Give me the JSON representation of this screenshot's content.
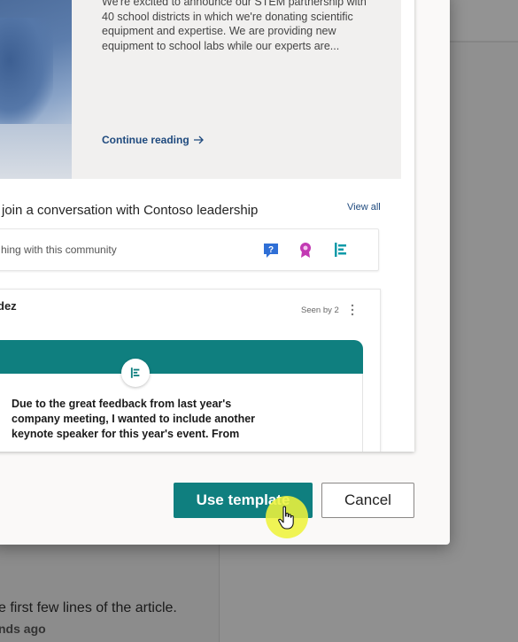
{
  "background_page": {
    "article_snippet": "e first few lines of the article.",
    "timestamp": "nds ago"
  },
  "dialog": {
    "preview": {
      "news_card": {
        "excerpt_lines": [
          "We're excited to announce our STEM partnership with",
          "40 school districts in which we're donating scientific",
          "equipment and expertise. We are providing new",
          "equipment to school labs while our experts are..."
        ],
        "continue_label": "Continue reading"
      },
      "community": {
        "title": "join a conversation with Contoso leadership",
        "view_all": "View all",
        "search_placeholder": "hing with this community",
        "icons": [
          "question-icon",
          "praise-badge-icon",
          "announcement-icon"
        ]
      },
      "post": {
        "author": "dez",
        "seen_by": "Seen by 2",
        "body": "Due to the great feedback from last year's company meeting, I wanted to include another keynote speaker for this year's event. From"
      }
    },
    "buttons": {
      "use_template": "Use template",
      "cancel": "Cancel"
    }
  },
  "colors": {
    "accent_teal": "#0f7f7f",
    "link_blue": "#1f4a7e",
    "overlay_gray": "#8f8f8f",
    "cursor_highlight": "#eef23c"
  }
}
